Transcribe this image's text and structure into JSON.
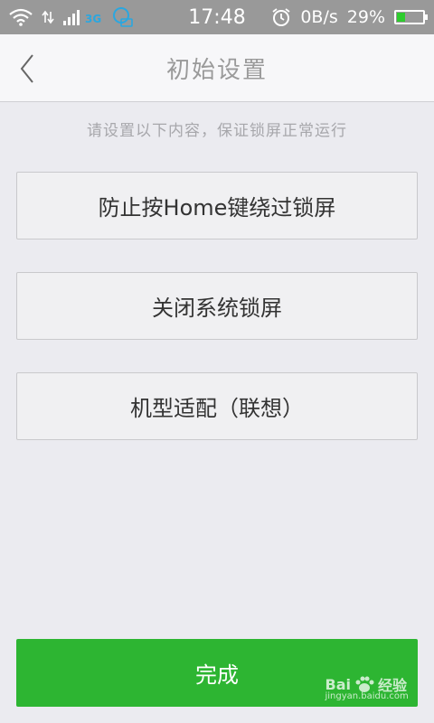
{
  "status_bar": {
    "network_type": "3G",
    "time": "17:48",
    "data_speed": "0B/s",
    "battery_percent": "29%",
    "battery_level": 0.29,
    "icons": [
      "wifi-icon",
      "data-arrows-icon",
      "signal-icon",
      "notification-icon",
      "alarm-icon",
      "battery-icon"
    ]
  },
  "header": {
    "title": "初始设置",
    "back_icon": "chevron-left-icon"
  },
  "main": {
    "subtitle": "请设置以下内容，保证锁屏正常运行",
    "options": [
      {
        "label": "防止按Home键绕过锁屏"
      },
      {
        "label": "关闭系统锁屏"
      },
      {
        "label": "机型适配（联想）"
      }
    ],
    "done_label": "完成"
  },
  "watermark": {
    "text": "Bai",
    "text2": "经验",
    "url": "jingyan.baidu.com"
  },
  "colors": {
    "accent": "#2db532",
    "status_bar": "#999999",
    "battery_fill": "#2ecc2e",
    "network_3g": "#2aa7e0"
  }
}
